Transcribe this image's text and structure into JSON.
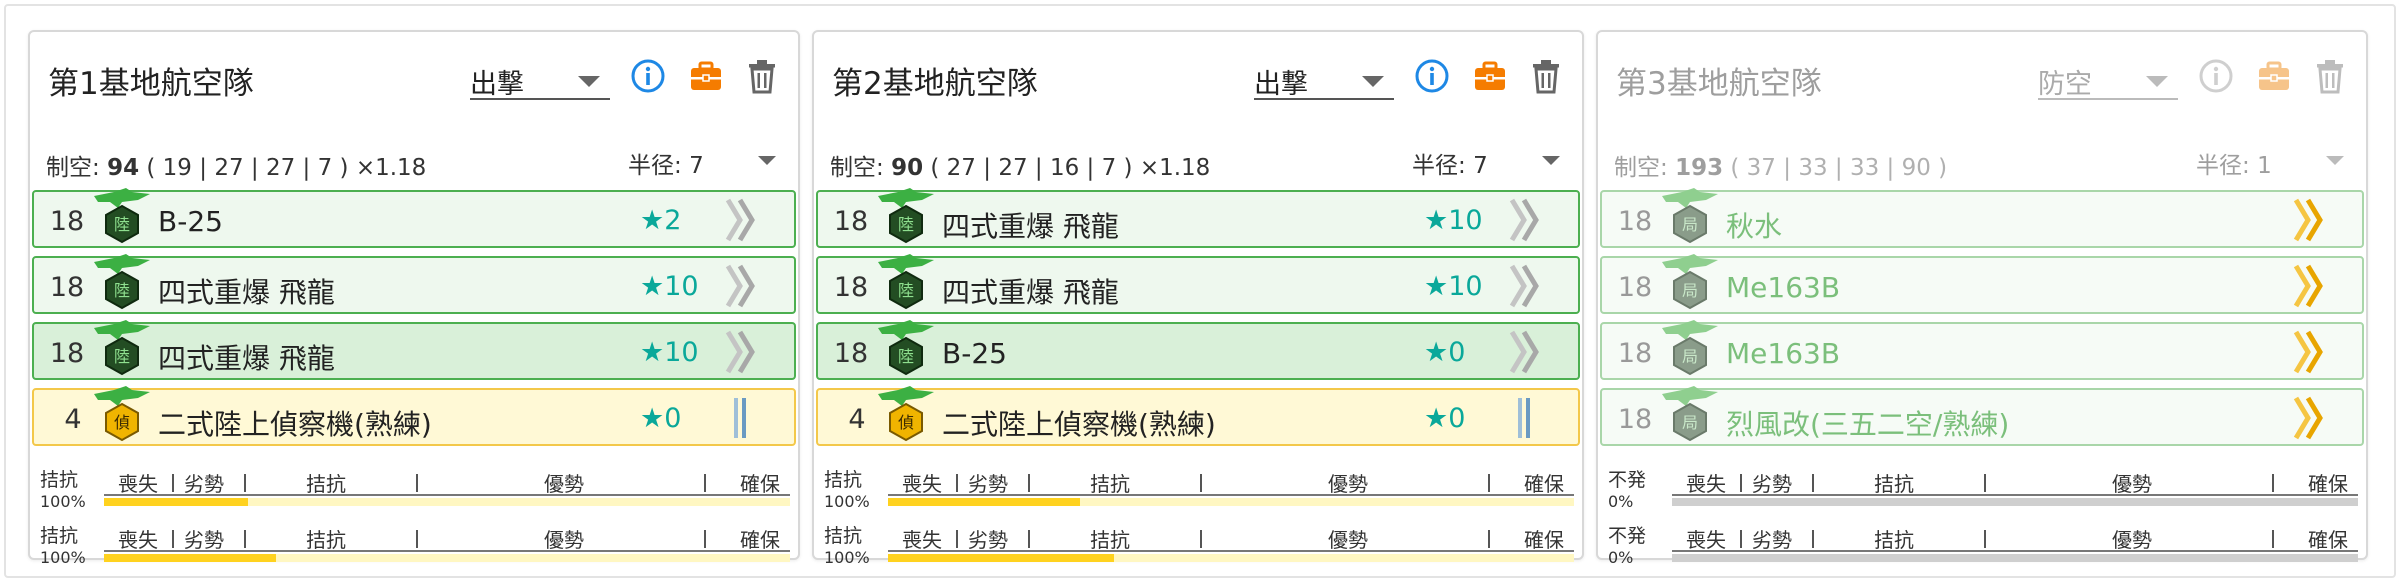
{
  "cards": [
    {
      "title": "第1基地航空隊",
      "mode": "出撃",
      "stats": {
        "label": "制空:",
        "value": "94",
        "breakdown": "( 19 | 27 | 27 | 7 ) ×1.18"
      },
      "radius": {
        "label": "半径:",
        "value": "7"
      },
      "disabled": false,
      "slots": [
        {
          "count": "18",
          "name": "B-25",
          "star": "★2",
          "badge": "陸",
          "kind": "attack",
          "highlight": false
        },
        {
          "count": "18",
          "name": "四式重爆 飛龍",
          "star": "★10",
          "badge": "陸",
          "kind": "attack",
          "highlight": false
        },
        {
          "count": "18",
          "name": "四式重爆 飛龍",
          "star": "★10",
          "badge": "陸",
          "kind": "attack",
          "highlight": true
        },
        {
          "count": "4",
          "name": "二式陸上偵察機(熟練)",
          "star": "★0",
          "badge": "偵",
          "kind": "recon",
          "highlight": false
        }
      ],
      "air_bars": [
        {
          "status": "拮抗",
          "percent": "100%",
          "fill": 0.21
        },
        {
          "status": "拮抗",
          "percent": "100%",
          "fill": 0.25
        }
      ]
    },
    {
      "title": "第2基地航空隊",
      "mode": "出撃",
      "stats": {
        "label": "制空:",
        "value": "90",
        "breakdown": "( 27 | 27 | 16 | 7 ) ×1.18"
      },
      "radius": {
        "label": "半径:",
        "value": "7"
      },
      "disabled": false,
      "slots": [
        {
          "count": "18",
          "name": "四式重爆 飛龍",
          "star": "★10",
          "badge": "陸",
          "kind": "attack",
          "highlight": false
        },
        {
          "count": "18",
          "name": "四式重爆 飛龍",
          "star": "★10",
          "badge": "陸",
          "kind": "attack",
          "highlight": false
        },
        {
          "count": "18",
          "name": "B-25",
          "star": "★0",
          "badge": "陸",
          "kind": "attack",
          "highlight": true
        },
        {
          "count": "4",
          "name": "二式陸上偵察機(熟練)",
          "star": "★0",
          "badge": "偵",
          "kind": "recon",
          "highlight": false
        }
      ],
      "air_bars": [
        {
          "status": "拮抗",
          "percent": "100%",
          "fill": 0.28
        },
        {
          "status": "拮抗",
          "percent": "100%",
          "fill": 0.33
        }
      ]
    },
    {
      "title": "第3基地航空隊",
      "mode": "防空",
      "stats": {
        "label": "制空:",
        "value": "193",
        "breakdown": "( 37 | 33 | 33 | 90 )"
      },
      "radius": {
        "label": "半径:",
        "value": "1"
      },
      "disabled": true,
      "slots": [
        {
          "count": "18",
          "name": "秋水",
          "star": "",
          "badge": "局",
          "kind": "intercept",
          "highlight": false
        },
        {
          "count": "18",
          "name": "Me163B",
          "star": "",
          "badge": "局",
          "kind": "intercept",
          "highlight": false
        },
        {
          "count": "18",
          "name": "Me163B",
          "star": "",
          "badge": "局",
          "kind": "intercept",
          "highlight": false
        },
        {
          "count": "18",
          "name": "烈風改(三五二空/熟練)",
          "star": "",
          "badge": "局",
          "kind": "intercept",
          "highlight": false
        }
      ],
      "air_bars": [
        {
          "status": "不発",
          "percent": "0%",
          "fill": 0
        },
        {
          "status": "不発",
          "percent": "0%",
          "fill": 0
        }
      ]
    }
  ],
  "scale_labels": [
    "喪失",
    "劣勢",
    "拮抗",
    "優勢",
    "確保"
  ],
  "colors": {
    "accent_blue": "#1e88e5",
    "accent_orange": "#f57c00",
    "slot_border": "#4caf50",
    "recon_border": "#f3c84a",
    "star": "#0aa89a",
    "bar_fill": "#ffd21f"
  },
  "icons": {
    "info": "info-icon",
    "bag": "briefcase-icon",
    "trash": "trash-icon",
    "plane": "plane-icon",
    "proficiency": "chevron-proficiency-icon"
  }
}
